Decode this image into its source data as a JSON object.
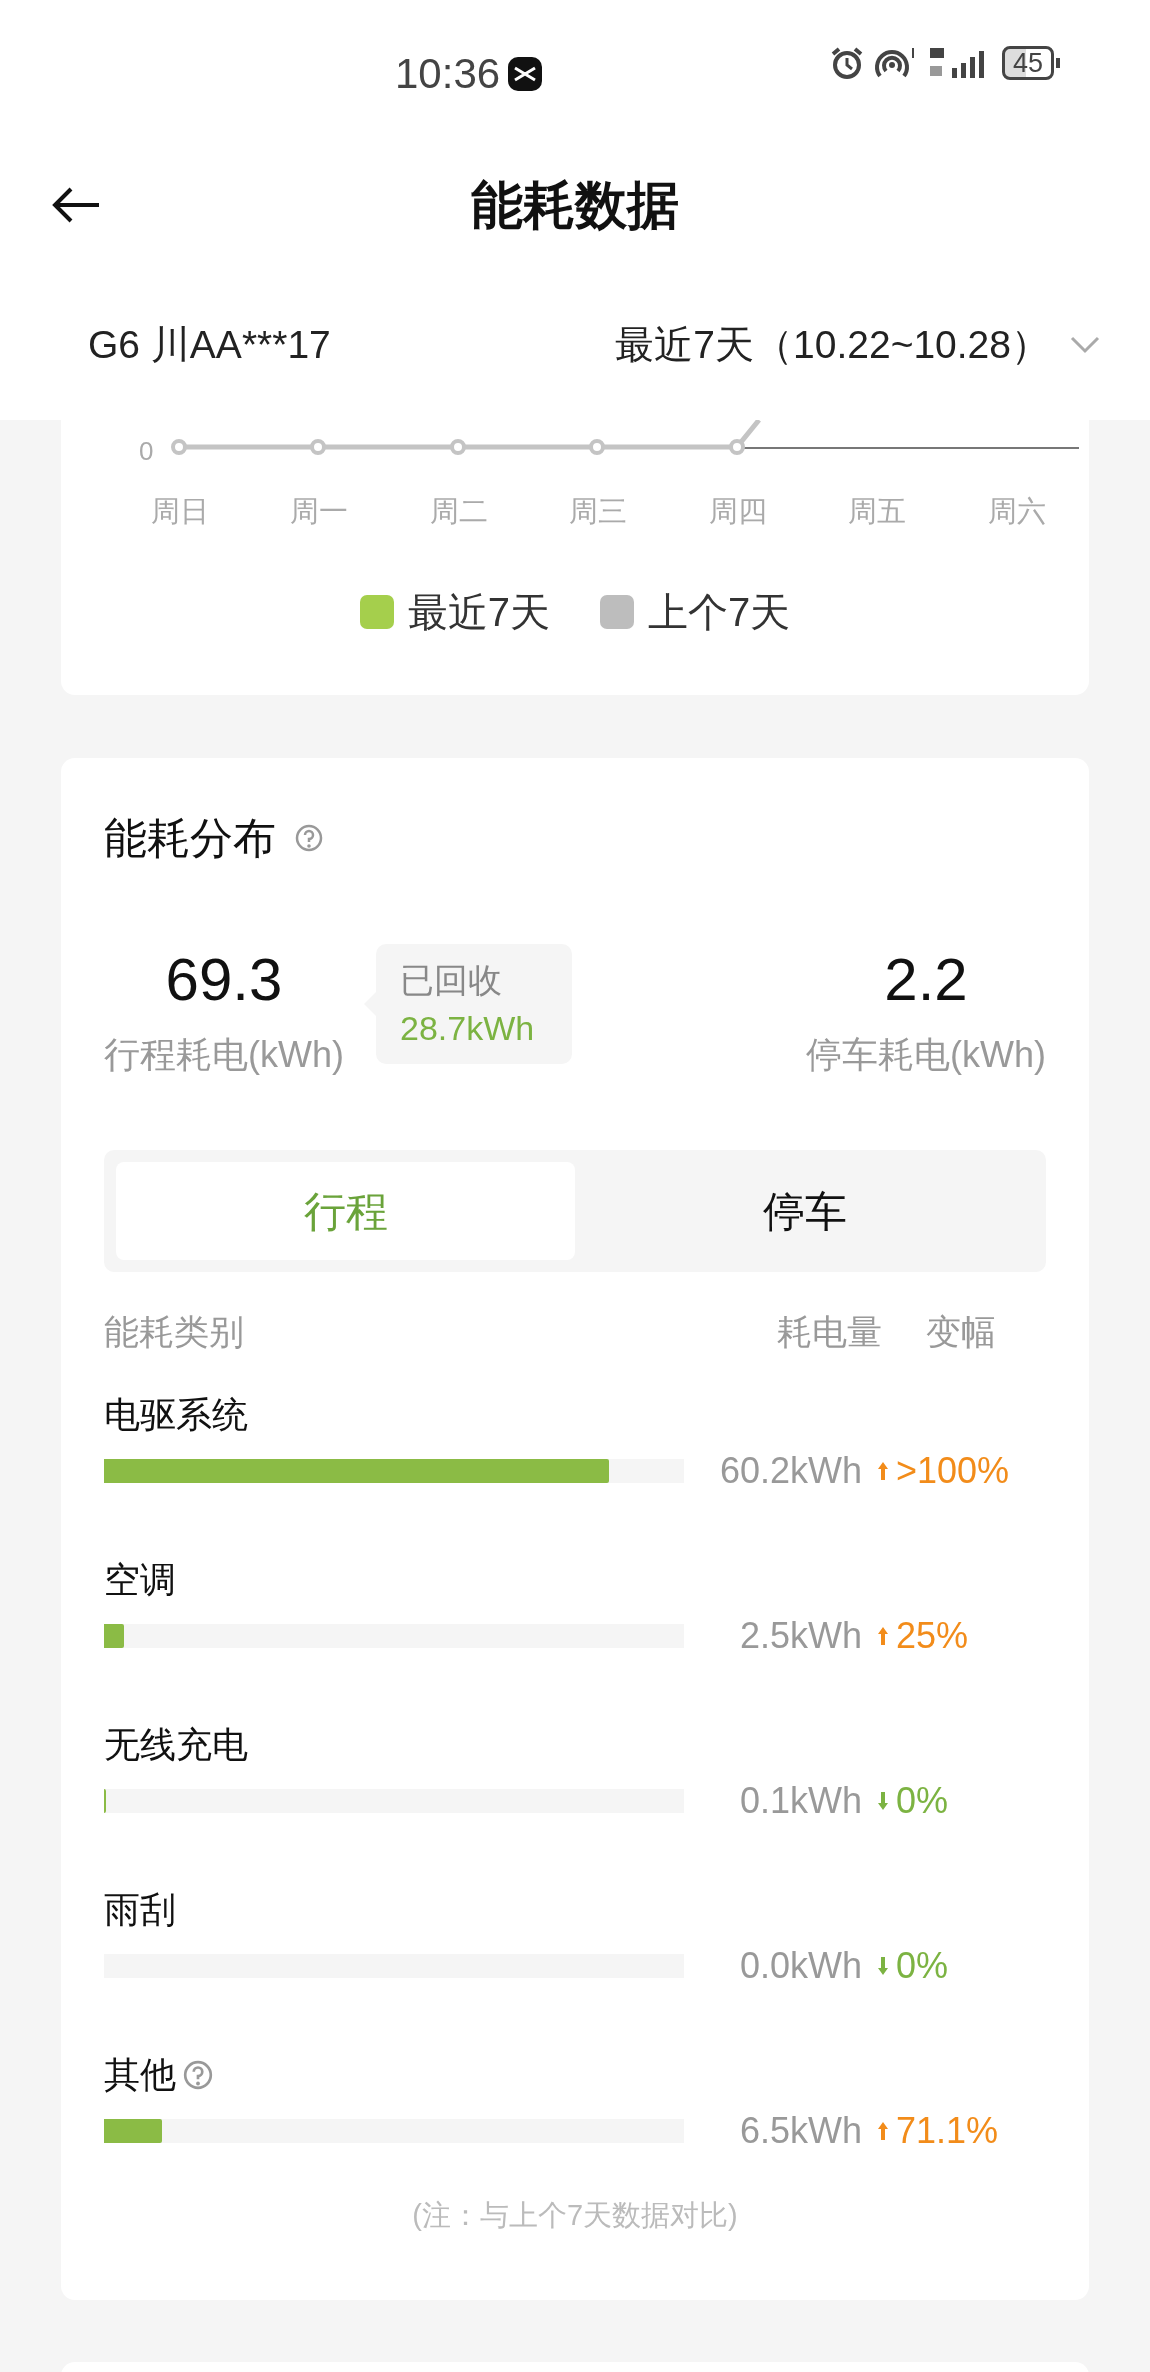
{
  "status_bar": {
    "time": "10:36",
    "battery": "45"
  },
  "header": {
    "title": "能耗数据"
  },
  "vehicle": {
    "name": "G6 川AA***17",
    "period": "最近7天（10.22~10.28）"
  },
  "trend_chart": {
    "y_label": "0",
    "days": [
      "周日",
      "周一",
      "周二",
      "周三",
      "周四",
      "周五",
      "周六"
    ],
    "legend": [
      {
        "label": "最近7天",
        "color": "#a5cf4c"
      },
      {
        "label": "上个7天",
        "color": "#bdbdbd"
      }
    ]
  },
  "distribution": {
    "title": "能耗分布",
    "drive": {
      "value": "69.3",
      "label": "行程耗电(kWh)"
    },
    "recovered": {
      "label": "已回收",
      "value": "28.7kWh"
    },
    "parking": {
      "value": "2.2",
      "label": "停车耗电(kWh)"
    },
    "tabs": [
      {
        "label": "行程",
        "selected": true
      },
      {
        "label": "停车",
        "selected": false
      }
    ],
    "columns": [
      "能耗类别",
      "耗电量",
      "变幅"
    ],
    "items": [
      {
        "name": "电驱系统",
        "level": 0.87,
        "amount": "60.2kWh",
        "change": ">100%",
        "kind": "increase",
        "info": false
      },
      {
        "name": "空调",
        "level": 0.035,
        "amount": "2.5kWh",
        "change": "25%",
        "kind": "increase",
        "info": false
      },
      {
        "name": "无线充电",
        "level": 0.003,
        "amount": "0.1kWh",
        "change": "0%",
        "kind": "decrease",
        "info": false
      },
      {
        "name": "雨刮",
        "level": 0,
        "amount": "0.0kWh",
        "change": "0%",
        "kind": "decrease",
        "info": false
      },
      {
        "name": "其他",
        "level": 0.1,
        "amount": "6.5kWh",
        "change": "71.1%",
        "kind": "increase",
        "info": true
      }
    ],
    "note": "(注：与上个7天数据对比)"
  }
}
